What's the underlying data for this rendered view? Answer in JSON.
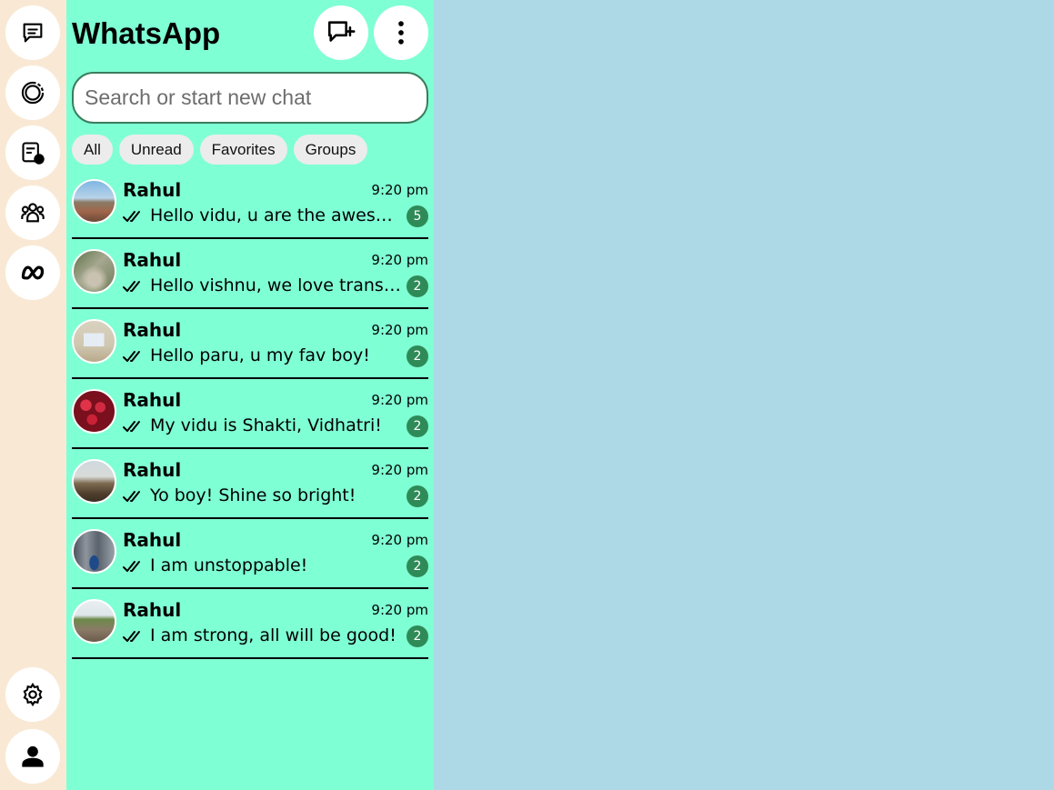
{
  "app": {
    "title": "WhatsApp"
  },
  "search": {
    "placeholder": "Search or start new chat",
    "value": ""
  },
  "filters": [
    "All",
    "Unread",
    "Favorites",
    "Groups"
  ],
  "chats": [
    {
      "name": "Rahul",
      "time": "9:20 pm",
      "message": "Hello vidu, u are the awesome girl!",
      "unread": "5"
    },
    {
      "name": "Rahul",
      "time": "9:20 pm",
      "message": "Hello vishnu, we love transformers!",
      "unread": "2"
    },
    {
      "name": "Rahul",
      "time": "9:20 pm",
      "message": "Hello paru, u my fav boy!",
      "unread": "2"
    },
    {
      "name": "Rahul",
      "time": "9:20 pm",
      "message": "My vidu is Shakti, Vidhatri!",
      "unread": "2"
    },
    {
      "name": "Rahul",
      "time": "9:20 pm",
      "message": "Yo boy! Shine so bright!",
      "unread": "2"
    },
    {
      "name": "Rahul",
      "time": "9:20 pm",
      "message": "I am unstoppable!",
      "unread": "2"
    },
    {
      "name": "Rahul",
      "time": "9:20 pm",
      "message": "I am strong, all will be good!",
      "unread": "2"
    }
  ],
  "icons": {
    "rail": [
      "chats-icon",
      "status-icon",
      "channels-icon",
      "communities-icon",
      "meta-ai-icon",
      "settings-icon",
      "profile-icon"
    ],
    "header": [
      "new-chat-icon",
      "more-options-icon"
    ],
    "message_status": "double-check-icon"
  },
  "colors": {
    "rail_bg": "#f9e9d4",
    "panel_bg": "#7fffd4",
    "main_bg": "#add8e6",
    "badge": "#2e8b57",
    "chip_bg": "#ececec"
  }
}
